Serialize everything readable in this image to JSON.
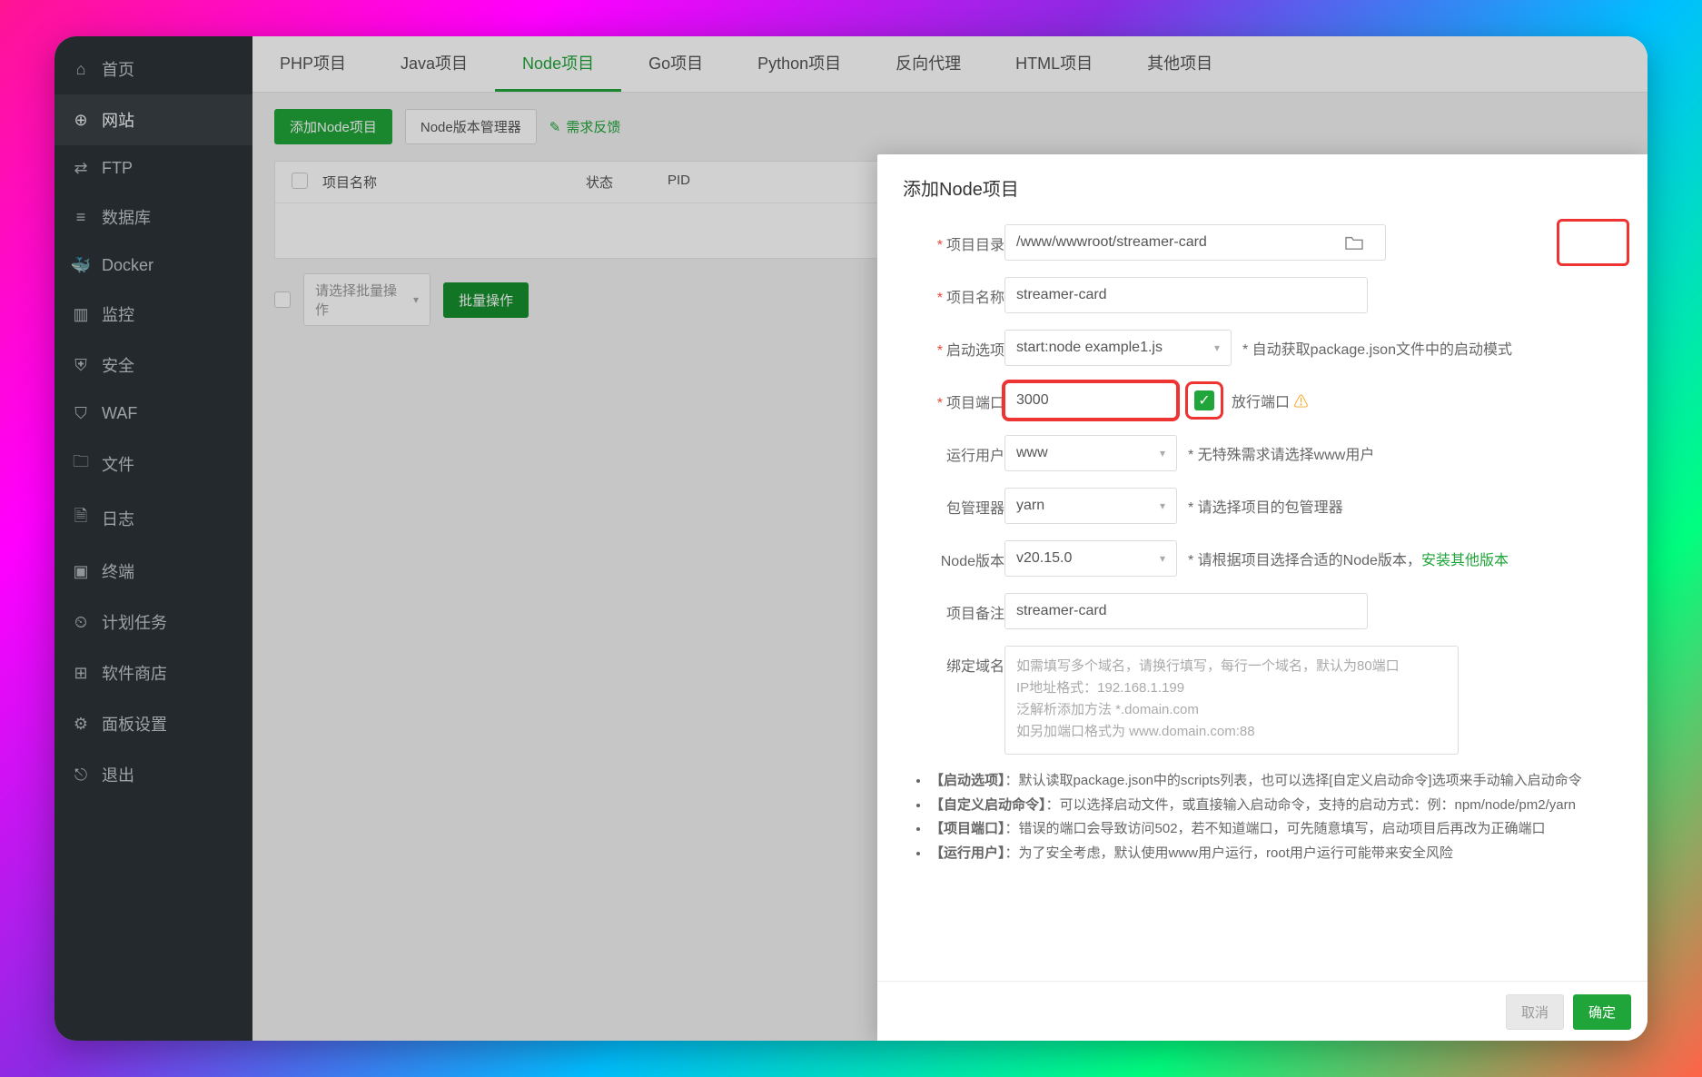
{
  "sidebar": {
    "items": [
      {
        "icon": "home",
        "label": "首页"
      },
      {
        "icon": "globe",
        "label": "网站",
        "active": true
      },
      {
        "icon": "ftp",
        "label": "FTP"
      },
      {
        "icon": "db",
        "label": "数据库"
      },
      {
        "icon": "docker",
        "label": "Docker"
      },
      {
        "icon": "monitor",
        "label": "监控"
      },
      {
        "icon": "shield",
        "label": "安全"
      },
      {
        "icon": "waf",
        "label": "WAF"
      },
      {
        "icon": "folder",
        "label": "文件"
      },
      {
        "icon": "log",
        "label": "日志"
      },
      {
        "icon": "terminal",
        "label": "终端"
      },
      {
        "icon": "cron",
        "label": "计划任务"
      },
      {
        "icon": "store",
        "label": "软件商店"
      },
      {
        "icon": "settings",
        "label": "面板设置"
      },
      {
        "icon": "logout",
        "label": "退出"
      }
    ]
  },
  "tabs": [
    {
      "label": "PHP项目"
    },
    {
      "label": "Java项目"
    },
    {
      "label": "Node项目",
      "active": true
    },
    {
      "label": "Go项目"
    },
    {
      "label": "Python项目"
    },
    {
      "label": "反向代理"
    },
    {
      "label": "HTML项目"
    },
    {
      "label": "其他项目"
    }
  ],
  "toolbar": {
    "add_button": "添加Node项目",
    "version_button": "Node版本管理器",
    "feedback_link": "需求反馈"
  },
  "table": {
    "cols": [
      "项目名称",
      "状态",
      "PID"
    ]
  },
  "batch": {
    "select_placeholder": "请选择批量操作",
    "action_button": "批量操作"
  },
  "modal": {
    "title": "添加Node项目",
    "labels": {
      "dir": "项目目录",
      "name": "项目名称",
      "start": "启动选项",
      "port": "项目端口",
      "port_release": "放行端口",
      "user": "运行用户",
      "pkg": "包管理器",
      "node": "Node版本",
      "remark": "项目备注",
      "domain": "绑定域名"
    },
    "values": {
      "dir": "/www/wwwroot/streamer-card",
      "name": "streamer-card",
      "start": "start:node example1.js",
      "port": "3000",
      "user": "www",
      "pkg": "yarn",
      "node": "v20.15.0",
      "remark": "streamer-card"
    },
    "hints": {
      "start": "* 自动获取package.json文件中的启动模式",
      "user": "* 无特殊需求请选择www用户",
      "pkg": "* 请选择项目的包管理器",
      "node_prefix": "* 请根据项目选择合适的Node版本，",
      "node_link": "安装其他版本"
    },
    "domain_placeholder_lines": [
      "如需填写多个域名，请换行填写，每行一个域名，默认为80端口",
      "IP地址格式：192.168.1.199",
      "泛解析添加方法 *.domain.com",
      "如另加端口格式为 www.domain.com:88"
    ],
    "notes": [
      {
        "label": "【启动选项】",
        "text": "：默认读取package.json中的scripts列表，也可以选择[自定义启动命令]选项来手动输入启动命令"
      },
      {
        "label": "【自定义启动命令】",
        "text": "：可以选择启动文件，或直接输入启动命令，支持的启动方式：例：npm/node/pm2/yarn"
      },
      {
        "label": "【项目端口】",
        "text": "：错误的端口会导致访问502，若不知道端口，可先随意填写，启动项目后再改为正确端口"
      },
      {
        "label": "【运行用户】",
        "text": "：为了安全考虑，默认使用www用户运行，root用户运行可能带来安全风险"
      }
    ],
    "buttons": {
      "cancel": "取消",
      "confirm": "确定"
    }
  }
}
